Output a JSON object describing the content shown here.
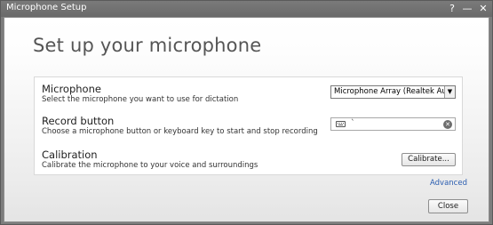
{
  "window": {
    "title": "Microphone Setup",
    "help_glyph": "?",
    "minimize_glyph": "—",
    "close_glyph": "✕"
  },
  "page": {
    "heading": "Set up your microphone"
  },
  "microphone": {
    "title": "Microphone",
    "description": "Select the microphone you want to use for dictation",
    "selected": "Microphone Array (Realtek Au..."
  },
  "record_button": {
    "title": "Record button",
    "description": "Choose a microphone button or keyboard key to start and stop recording",
    "key_value": "`",
    "keyboard_icon": "keyboard-icon",
    "clear_icon": "clear-icon"
  },
  "calibration": {
    "title": "Calibration",
    "description": "Calibrate the microphone to your voice and surroundings",
    "button_label": "Calibrate..."
  },
  "footer": {
    "advanced_label": "Advanced",
    "close_label": "Close"
  },
  "colors": {
    "link": "#2a5db0",
    "titlebar": "#727272"
  }
}
